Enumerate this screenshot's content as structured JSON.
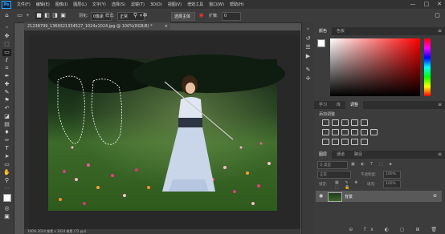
{
  "app": {
    "logo": "Ps"
  },
  "menu": {
    "items": [
      "文件(F)",
      "编辑(E)",
      "图像(I)",
      "图层(L)",
      "文字(Y)",
      "选择(S)",
      "滤镜(T)",
      "3D(D)",
      "视图(V)",
      "增效工具",
      "窗口(W)",
      "帮助(H)"
    ],
    "window_controls": [
      "—",
      "□",
      "✕"
    ]
  },
  "options": {
    "feather_label": "羽化:",
    "feather_value": "0像素",
    "style_label": "样式:",
    "style_value": "正常",
    "select_subject_label": "选择主体",
    "expand_label": "扩散:",
    "expand_value": "0"
  },
  "document": {
    "tab_title": "21238799_1369321334527_1024x1024.jpg @ 100%(RGB/8) *",
    "close_glyph": "×",
    "status_text": "100%    1024 像素 x 1024 像素 (72 ppi)"
  },
  "colors": {
    "panel_tabs": [
      "颜色",
      "色板"
    ]
  },
  "adjustments": {
    "tabs": [
      "学习",
      "库",
      "调整"
    ],
    "add_label": "添加调整"
  },
  "layers": {
    "tabs": [
      "图层",
      "通道",
      "路径"
    ],
    "kind_label": "Q 类型",
    "blend_mode": "正常",
    "opacity_label": "不透明度:",
    "opacity_value": "100%",
    "lock_label": "锁定:",
    "fill_label": "填充:",
    "fill_value": "100%",
    "items": [
      {
        "name": "背景"
      }
    ]
  },
  "theme": {
    "accent": "#31a8ff",
    "app_bg": "#535353",
    "panel_bg": "#3c3c3c"
  }
}
